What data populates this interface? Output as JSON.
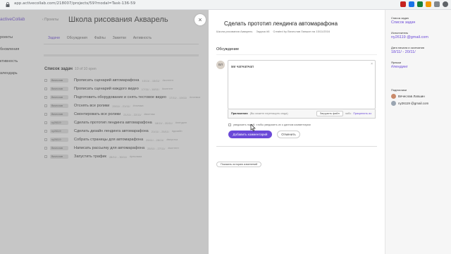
{
  "browser": {
    "url": "app.activecollab.com/218007/projects/59?modal=Task-136-59"
  },
  "colors": {
    "accent": "#6b49d8",
    "primary_button": "#6b49d8"
  },
  "sidebar": {
    "logo": "activeCollab",
    "items": [
      {
        "label": "роекты"
      },
      {
        "label": "бновления"
      },
      {
        "label": "ктивность"
      },
      {
        "label": "алендарь"
      }
    ]
  },
  "project": {
    "back_label": "‹ Проекты",
    "title": "Школа рисования Акварель",
    "tabs": [
      "Задачи",
      "Обсуждения",
      "Файлы",
      "Заметки",
      "Активность"
    ],
    "task_list_title": "Список задач",
    "task_count": "10 of 10 open",
    "tasks": [
      {
        "assignee": "Вячеслав",
        "name": "Прописать сценарий автомарафона",
        "dates": "10/11/ - 15/11/",
        "tag": "#контент"
      },
      {
        "assignee": "Вячеслав",
        "name": "Прописать сценарий каждого видео",
        "dates": "17/11/ - 18/11/",
        "tag": "#контент"
      },
      {
        "assignee": "Вячеслав",
        "name": "Подготовить оборудование и снять тестовое видео",
        "dates": "17/11/ - 19/11/",
        "tag": "#съемка"
      },
      {
        "assignee": "Вячеслав",
        "name": "Отснять все ролики",
        "dates": "20/11/ - 21/11/",
        "tag": "#съемка"
      },
      {
        "assignee": "Вячеслав",
        "name": "Смонтировать все ролики",
        "dates": "21/11/ - 22/11/",
        "tag": "#монтаж"
      },
      {
        "assignee": "ny26119",
        "name": "Сделать прототип лендинга автомарафона",
        "dates": "18/11/ - 20/11/",
        "tag": "#лендинг"
      },
      {
        "assignee": "ny26119",
        "name": "Сделать дизайн лендинга автомарафона",
        "dates": "21/11/ - 25/11/",
        "tag": "#дизайн"
      },
      {
        "assignee": "ny26119",
        "name": "Собрать страницы для автомарафона",
        "dates": "25/11/ - 28/11/",
        "tag": "#верстка"
      },
      {
        "assignee": "Вячеслав",
        "name": "Написать рассылку для автомарафона",
        "dates": "25/11/ - 27/11/",
        "tag": "#контент"
      },
      {
        "assignee": "Вячеслав",
        "name": "Запустить трафик",
        "dates": "28/11/ - 30/11/",
        "tag": "#реклама"
      }
    ]
  },
  "modal": {
    "close_glyph": "×",
    "title": "Сделать прототип лендинга автомарафона",
    "meta": {
      "project": "Школа рисования Акварель",
      "task_number": "Задача #6",
      "created": "Created by Вячеслав Лапшин на 15/11/2016"
    },
    "discussion_label": "Обсуждение",
    "avatar_initials": "ВЛ",
    "comment_text": "ми чапчапчап",
    "editor_corner": "×",
    "attachments": {
      "label": "Приложения",
      "hint": "(Вы можете перетащить сюда)",
      "upload": "Загрузить файл",
      "or": "либо",
      "link": "Прикрепить из"
    },
    "notify_text": "уведомить подей, чтобы уведомить их о данном комментарии",
    "submit_label": "Добавить комментарий",
    "cancel_label": "Отменить",
    "history_label": "Показать историю изменений"
  },
  "details": {
    "task_list_label": "Список задач",
    "task_list_value": "Список задач",
    "assignee_label": "Исполнитель",
    "assignee_value": "ny26119 @gmail.com",
    "dates_label": "Дата начала и окончания",
    "dates_value": "18/11/ - 20/11/",
    "labels_label": "Ярлыки",
    "labels_value": "#лендинг",
    "subscribers_label": "Подписчики",
    "subscribers": [
      {
        "name": "Вячеслав Лапшин",
        "color": "#c98a6a"
      },
      {
        "name": "ny26119 @gmail.com",
        "color": "#9aa5b1"
      }
    ]
  }
}
